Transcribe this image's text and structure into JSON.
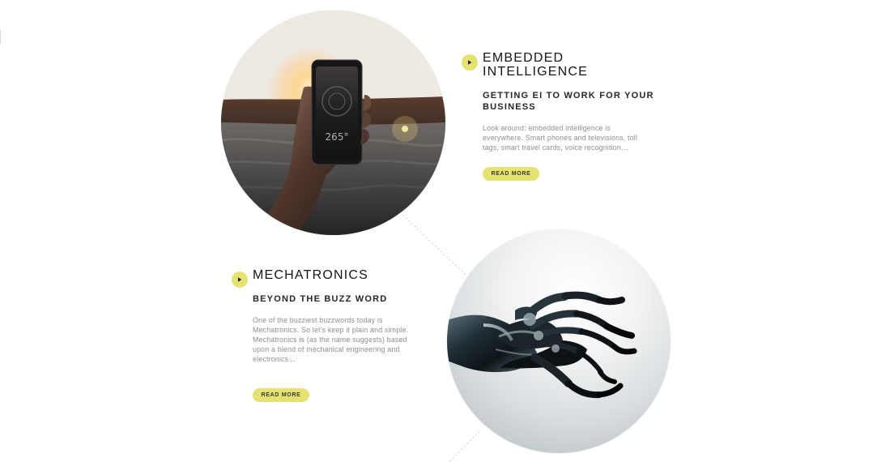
{
  "sections": [
    {
      "title": "EMBEDDED INTELLIGENCE",
      "subtitle": "GETTING EI TO WORK FOR YOUR BUSINESS",
      "description": "Look around: embedded intelligence is everywhere. Smart phones and televisions, toll tags, smart travel cards, voice recognition…",
      "button_label": "READ MORE",
      "icon": "play-icon",
      "image": "smartphone-sunset-image"
    },
    {
      "title": "MECHATRONICS",
      "subtitle": "BEYOND THE BUZZ WORD",
      "description": "One of the buzziest buzzwords today is Mechatronics. So let's keep it plain and simple. Mechatronics is (as the name suggests) based upon a blend of mechanical engineering and electronics…",
      "button_label": "READ MORE",
      "icon": "play-icon",
      "image": "robotic-hand-image"
    }
  ],
  "colors": {
    "accent": "#e6e26f",
    "heading": "#151515",
    "text": "#8d8d8d",
    "background": "#ffffff"
  }
}
